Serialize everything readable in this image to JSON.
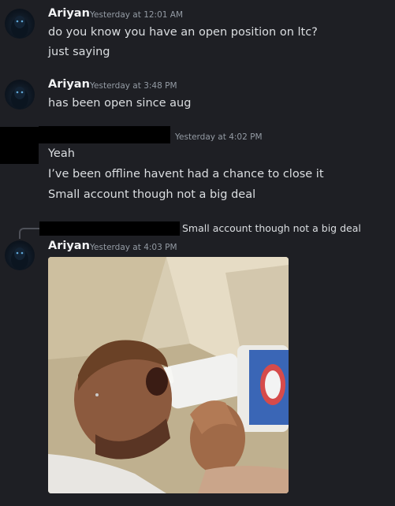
{
  "messages": [
    {
      "author": "Ariyan",
      "timestamp": "Yesterday at 12:01 AM",
      "lines": [
        "do you know you have an open position on ltc?",
        "just saying"
      ]
    },
    {
      "author": "Ariyan",
      "timestamp": "Yesterday at 3:48 PM",
      "lines": [
        "has been open since aug"
      ]
    },
    {
      "author": "",
      "timestamp": "Yesterday at 4:02 PM",
      "lines": [
        "Yeah",
        "I’ve been offline havent had a chance to close it",
        "Small account though not a big deal"
      ]
    },
    {
      "author": "Ariyan",
      "timestamp": "Yesterday at 4:03 PM",
      "reply_to": "Small account though not a big deal",
      "attachment": "image-attachment"
    }
  ],
  "colors": {
    "background": "#1e1f24",
    "text": "#dbdee1",
    "username": "#f2f3f5",
    "timestamp": "#949ba4",
    "redaction": "#000000"
  }
}
